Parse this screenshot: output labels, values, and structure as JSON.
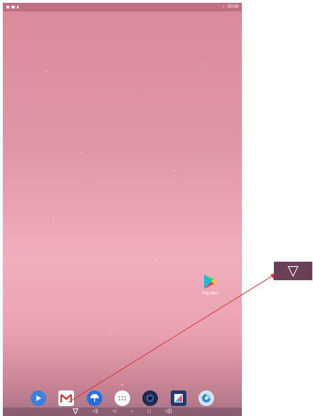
{
  "status_bar": {
    "time": "00:09",
    "status_icon": "signal-dot"
  },
  "desktop": {
    "app_label": "Play Store"
  },
  "dock": {
    "apps": [
      {
        "name": "play-video-app",
        "color": "#3d7fe0"
      },
      {
        "name": "gmail-app",
        "color": "#ffffff"
      },
      {
        "name": "weather-app",
        "color": "#2a6fd8"
      },
      {
        "name": "app-drawer",
        "color": "#ffffff"
      },
      {
        "name": "camera-app",
        "color": "#1d2a4a"
      },
      {
        "name": "gallery-app",
        "color": "#243a6e"
      },
      {
        "name": "browser-app",
        "color": "#d3e4f0"
      }
    ]
  },
  "navigation": {
    "drawer_handle": "^",
    "primary": "▽",
    "volume_down": "◁)",
    "back": "◁",
    "home": "○",
    "recents": "□",
    "volume_up": "◁))"
  },
  "zoom_annotation": {
    "symbol": "▽",
    "color": "#6b3f55",
    "arrow_color": "#e0303a"
  }
}
